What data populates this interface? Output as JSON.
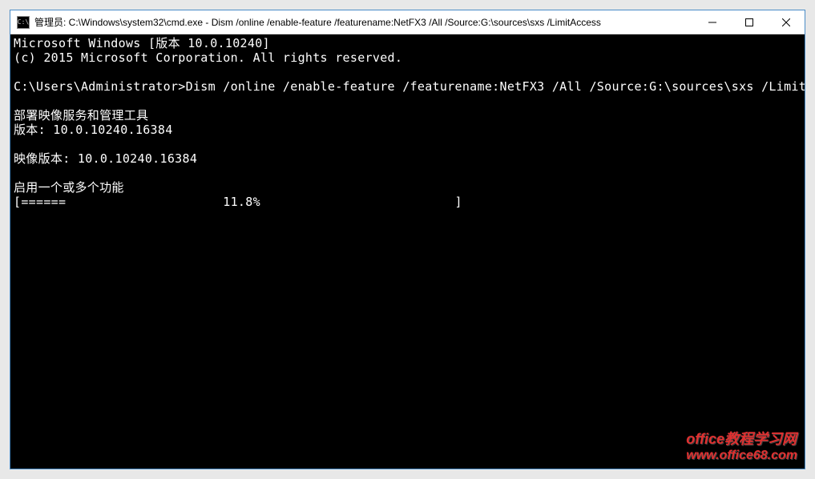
{
  "titlebar": {
    "icon_label": "C:\\",
    "title": "管理员: C:\\Windows\\system32\\cmd.exe - Dism  /online /enable-feature /featurename:NetFX3 /All /Source:G:\\sources\\sxs /LimitAccess"
  },
  "terminal": {
    "line1": "Microsoft Windows [版本 10.0.10240]",
    "line2": "(c) 2015 Microsoft Corporation. All rights reserved.",
    "blank1": "",
    "prompt_line": "C:\\Users\\Administrator>Dism /online /enable-feature /featurename:NetFX3 /All /Source:G:\\sources\\sxs /LimitAccess",
    "blank2": "",
    "line_tool": "部署映像服务和管理工具",
    "line_version": "版本: 10.0.10240.16384",
    "blank3": "",
    "line_image_version": "映像版本: 10.0.10240.16384",
    "blank4": "",
    "line_enable": "启用一个或多个功能",
    "progress": "[======                     11.8%                          ] "
  },
  "watermark": {
    "line1": "office教程学习网",
    "line2": "www.office68.com"
  }
}
